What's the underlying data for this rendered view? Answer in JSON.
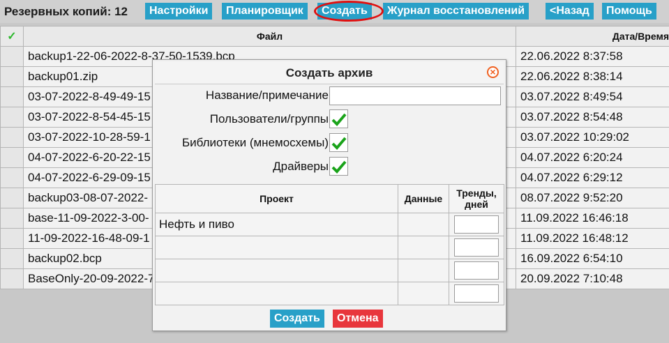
{
  "toolbar": {
    "count_label": "Резервных копий: 12",
    "buttons": {
      "settings": "Настройки",
      "scheduler": "Планировщик",
      "create": "Создать",
      "restore_log": "Журнал восстановлений",
      "back": "<Назад",
      "help": "Помощь"
    }
  },
  "grid": {
    "columns": {
      "check": "✓",
      "file": "Файл",
      "date": "Дата/Время"
    },
    "rows": [
      {
        "file": "backup1-22-06-2022-8-37-50-1539.bcp",
        "date": "22.06.2022 8:37:58"
      },
      {
        "file": "backup01.zip",
        "date": "22.06.2022 8:38:14"
      },
      {
        "file": "03-07-2022-8-49-49-15",
        "date": "03.07.2022 8:49:54"
      },
      {
        "file": "03-07-2022-8-54-45-15",
        "date": "03.07.2022 8:54:48"
      },
      {
        "file": "03-07-2022-10-28-59-1",
        "date": "03.07.2022 10:29:02"
      },
      {
        "file": "04-07-2022-6-20-22-15",
        "date": "04.07.2022 6:20:24"
      },
      {
        "file": "04-07-2022-6-29-09-15",
        "date": "04.07.2022 6:29:12"
      },
      {
        "file": "backup03-08-07-2022-",
        "date": "08.07.2022 9:52:20"
      },
      {
        "file": "base-11-09-2022-3-00-",
        "date": "11.09.2022 16:46:18"
      },
      {
        "file": "11-09-2022-16-48-09-1",
        "date": "11.09.2022 16:48:12"
      },
      {
        "file": "backup02.bcp",
        "date": "16.09.2022 6:54:10"
      },
      {
        "file": "BaseOnly-20-09-2022-7",
        "date": "20.09.2022 7:10:48"
      }
    ]
  },
  "dialog": {
    "title": "Создать архив",
    "fields": {
      "name_label": "Название/примечание",
      "name_value": "",
      "users_label": "Пользователи/группы",
      "users_checked": true,
      "libs_label": "Библиотеки (мнемосхемы)",
      "libs_checked": true,
      "drivers_label": "Драйверы",
      "drivers_checked": true
    },
    "table": {
      "headers": {
        "project": "Проект",
        "data": "Данные",
        "trends_line1": "Тренды,",
        "trends_line2": "дней"
      },
      "rows": [
        {
          "project": "Нефть и пиво",
          "data": "",
          "trends": ""
        },
        {
          "project": "",
          "data": "",
          "trends": ""
        },
        {
          "project": "",
          "data": "",
          "trends": ""
        },
        {
          "project": "",
          "data": "",
          "trends": ""
        }
      ]
    },
    "buttons": {
      "create": "Создать",
      "cancel": "Отмена"
    }
  },
  "colors": {
    "toolbar_button": "#28a0c8",
    "cancel_button": "#e8363c",
    "check_green": "#1aa31a",
    "highlight_red": "#e01010"
  }
}
